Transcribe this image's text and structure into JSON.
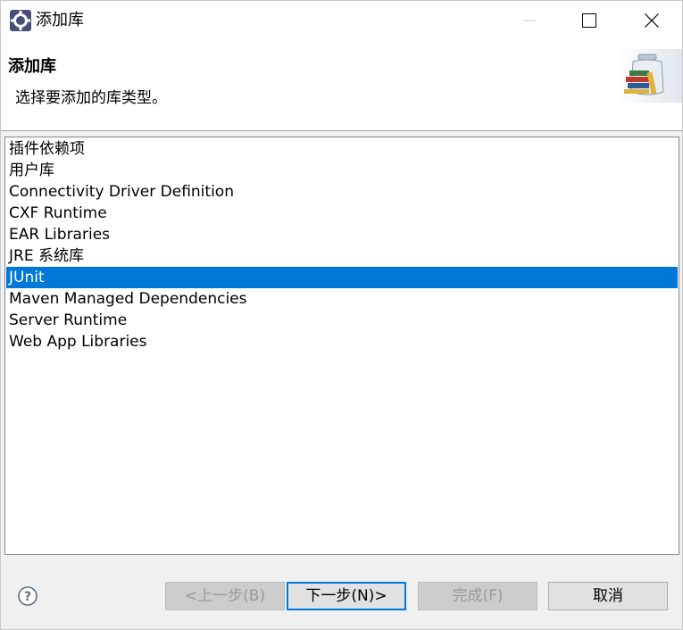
{
  "window": {
    "title": "添加库",
    "icon": "eclipse-gear-icon",
    "controls": [
      "minimize-icon",
      "maximize-icon",
      "close-icon"
    ]
  },
  "banner": {
    "title": "添加库",
    "description": "选择要添加的库类型。",
    "image": "library-jar-icon"
  },
  "library_list": {
    "items": [
      "插件依赖项",
      "用户库",
      "Connectivity Driver Definition",
      "CXF Runtime",
      "EAR Libraries",
      "JRE 系统库",
      "JUnit",
      "Maven Managed Dependencies",
      "Server Runtime",
      "Web App Libraries"
    ],
    "selected": "JUnit",
    "selected_color": "#0078d7"
  },
  "footer": {
    "help_icon": "help-icon",
    "back_label": "<上一步(B)",
    "next_label": "下一步(N)>",
    "finish_label": "完成(F)",
    "cancel_label": "取消"
  }
}
